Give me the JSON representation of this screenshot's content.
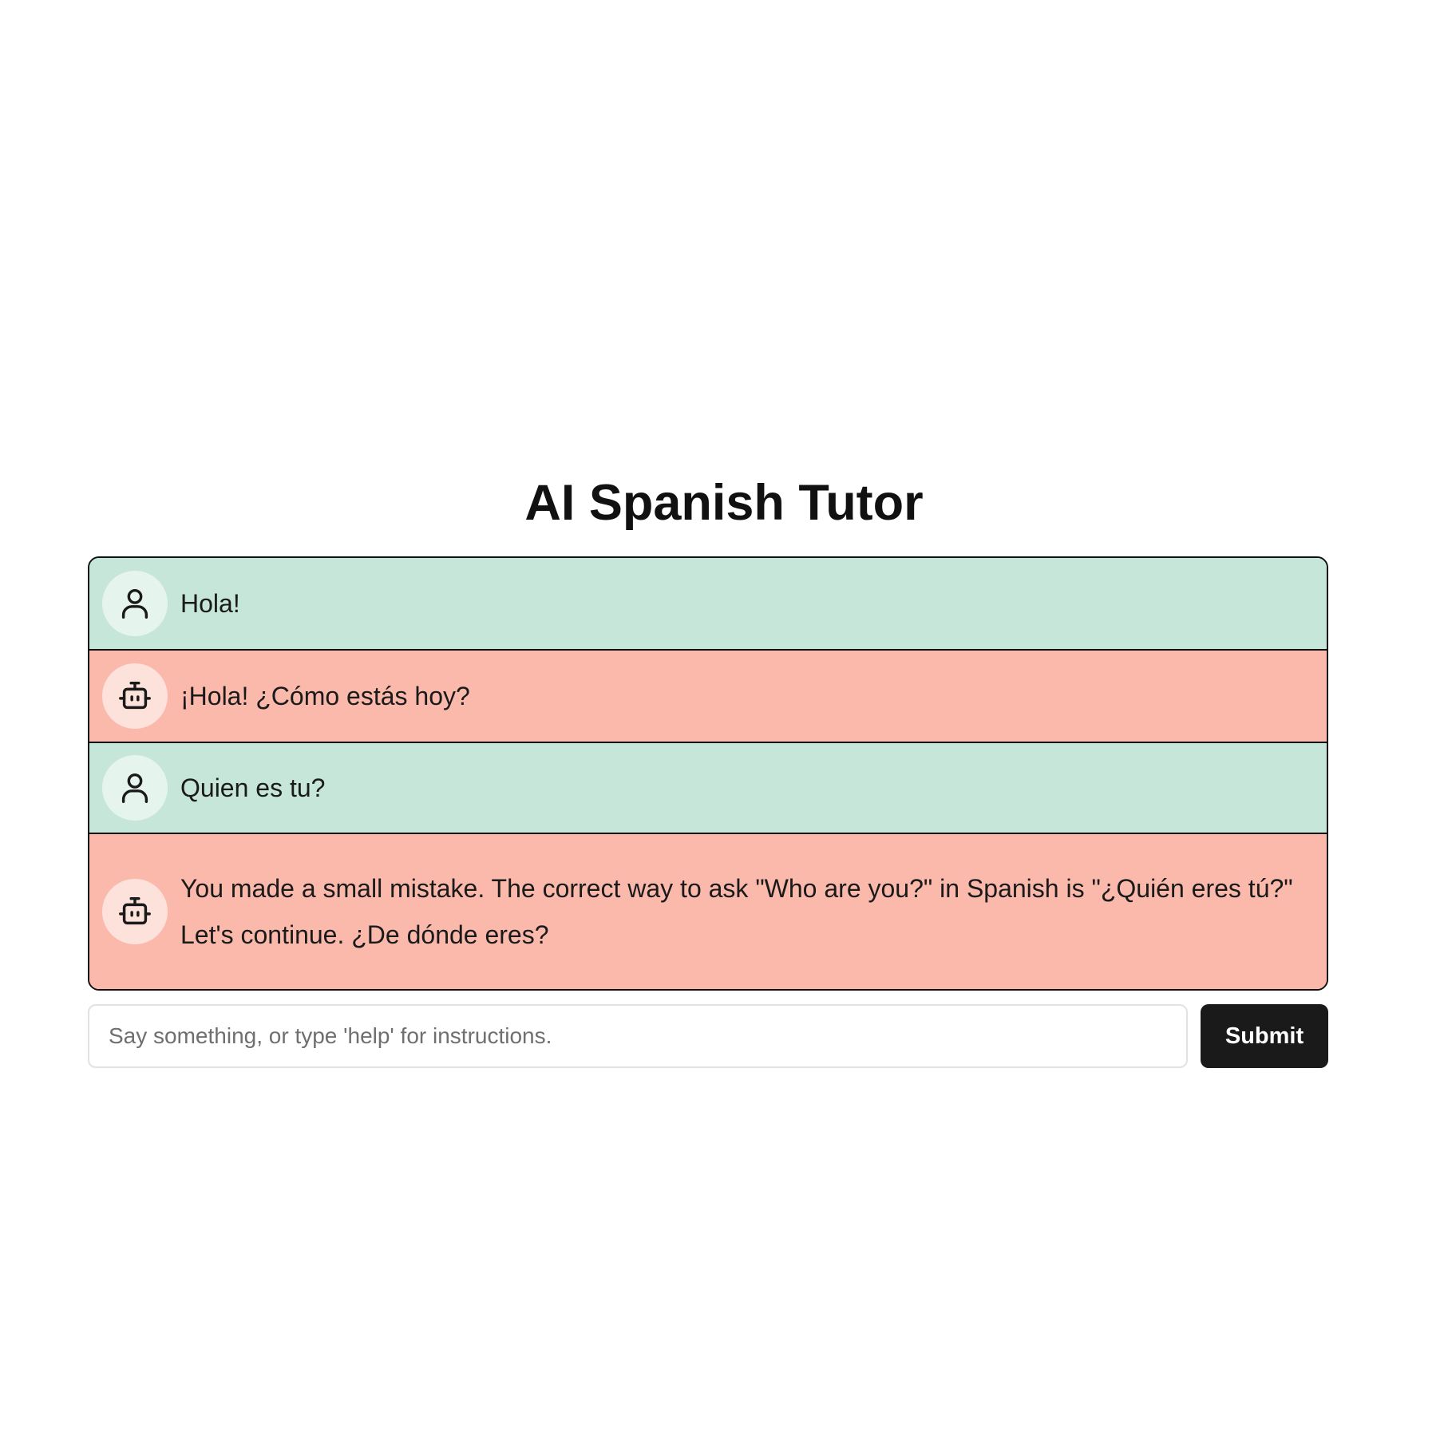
{
  "page": {
    "title": "AI Spanish Tutor"
  },
  "colors": {
    "user_message_bg": "#c6e6d9",
    "bot_message_bg": "#fbb9ac",
    "submit_bg": "#1a1a1a"
  },
  "messages": [
    {
      "role": "user",
      "icon": "user-icon",
      "lines": [
        "Hola!"
      ]
    },
    {
      "role": "bot",
      "icon": "robot-icon",
      "lines": [
        "¡Hola! ¿Cómo estás hoy?"
      ]
    },
    {
      "role": "user",
      "icon": "user-icon",
      "lines": [
        "Quien es tu?"
      ]
    },
    {
      "role": "bot",
      "icon": "robot-icon",
      "lines": [
        "You made a small mistake. The correct way to ask \"Who are you?\" in Spanish is \"¿Quién eres tú?\"",
        "Let's continue. ¿De dónde eres?"
      ]
    }
  ],
  "input": {
    "value": "",
    "placeholder": "Say something, or type 'help' for instructions."
  },
  "submit": {
    "label": "Submit"
  }
}
